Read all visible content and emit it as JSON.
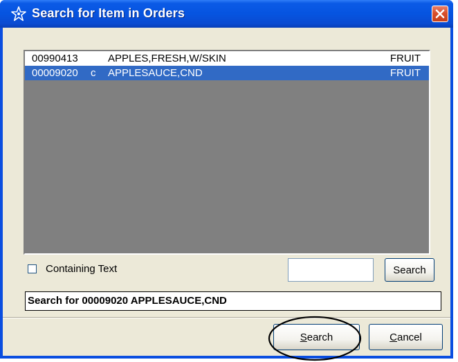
{
  "window": {
    "title": "Search for Item in Orders",
    "title_icon": "star-outline-icon",
    "close_icon": "close-icon"
  },
  "results": [
    {
      "code": "00990413",
      "flag": "",
      "description": "APPLES,FRESH,W/SKIN",
      "category": "FRUIT",
      "selected": false
    },
    {
      "code": "00009020",
      "flag": "c",
      "description": "APPLESAUCE,CND",
      "category": "FRUIT",
      "selected": true
    }
  ],
  "filter": {
    "checkbox_label": "Containing Text",
    "checked": false,
    "text_value": "",
    "search_button_label": "Search"
  },
  "status_text": "Search for 00009020 APPLESAUCE,CND",
  "footer": {
    "search_button_label": "Search",
    "search_mnemonic": "S",
    "search_rest": "earch",
    "cancel_button_label": "Cancel",
    "cancel_mnemonic": "C",
    "cancel_rest": "ancel"
  },
  "colors": {
    "title_bar": "#0654e0",
    "selection": "#316ac5",
    "list_background": "#808080",
    "dialog_face": "#ece9d8",
    "close_button": "#d9502c"
  }
}
